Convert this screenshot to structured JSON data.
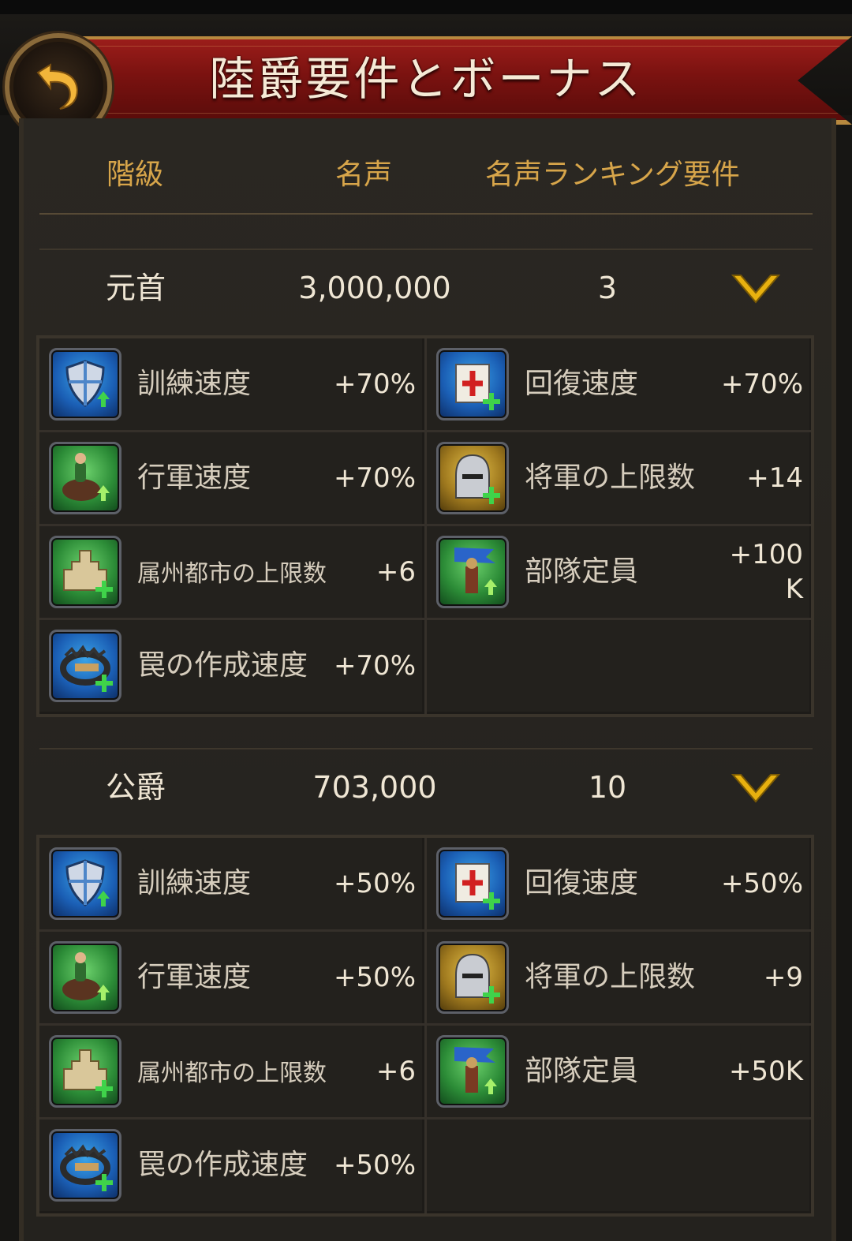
{
  "header": {
    "title": "陸爵要件とボーナス"
  },
  "columns": {
    "rank": "階級",
    "fame": "名声",
    "ranking_req": "名声ランキング要件"
  },
  "ranks": [
    {
      "name": "元首",
      "fame": "3,000,000",
      "requirement": "3",
      "bonuses": [
        {
          "icon": "shield-icon",
          "label": "訓練速度",
          "value": "+70%"
        },
        {
          "icon": "banner-icon",
          "label": "回復速度",
          "value": "+70%"
        },
        {
          "icon": "horseman-icon",
          "label": "行軍速度",
          "value": "+70%"
        },
        {
          "icon": "helmet-icon",
          "label": "将軍の上限数",
          "value": "+14"
        },
        {
          "icon": "castle-icon",
          "label": "属州都市の上限数",
          "value": "+6"
        },
        {
          "icon": "soldier-flag-icon",
          "label": "部隊定員",
          "value": "+100",
          "value2": "K"
        },
        {
          "icon": "trap-icon",
          "label": "罠の作成速度",
          "value": "+70%"
        }
      ]
    },
    {
      "name": "公爵",
      "fame": "703,000",
      "requirement": "10",
      "bonuses": [
        {
          "icon": "shield-icon",
          "label": "訓練速度",
          "value": "+50%"
        },
        {
          "icon": "banner-icon",
          "label": "回復速度",
          "value": "+50%"
        },
        {
          "icon": "horseman-icon",
          "label": "行軍速度",
          "value": "+50%"
        },
        {
          "icon": "helmet-icon",
          "label": "将軍の上限数",
          "value": "+9"
        },
        {
          "icon": "castle-icon",
          "label": "属州都市の上限数",
          "value": "+6"
        },
        {
          "icon": "soldier-flag-icon",
          "label": "部隊定員",
          "value": "+50K"
        },
        {
          "icon": "trap-icon",
          "label": "罠の作成速度",
          "value": "+50%"
        }
      ]
    }
  ]
}
